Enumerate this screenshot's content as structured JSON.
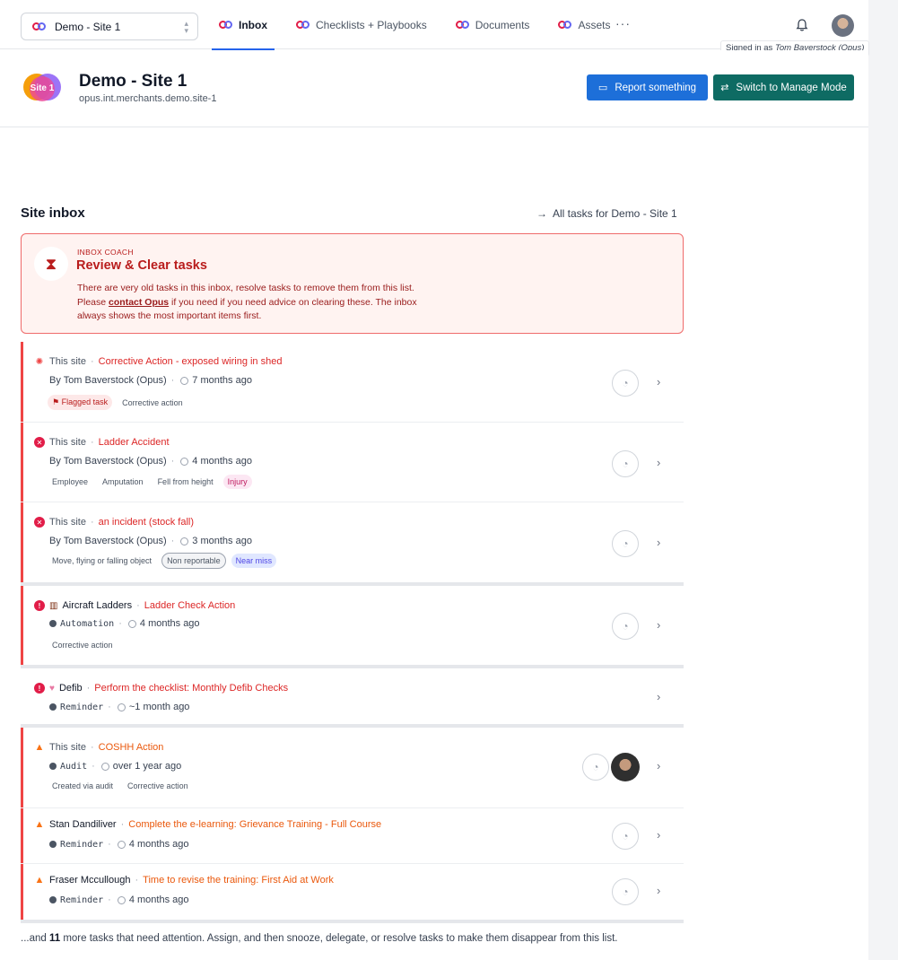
{
  "nav": {
    "site_select": "Demo - Site 1",
    "tabs": [
      {
        "label": "Inbox",
        "active": true
      },
      {
        "label": "Checklists + Playbooks",
        "active": false
      },
      {
        "label": "Documents",
        "active": false
      },
      {
        "label": "Assets",
        "active": false
      }
    ],
    "more": "···",
    "signed_in_prefix": "Signed in as",
    "signed_in_user": "Tom Baverstock (Opus)"
  },
  "site": {
    "badge_text": "Site 1",
    "name": "Demo - Site 1",
    "domain": "opus.int.merchants.demo.site-1",
    "report_button": "Report something",
    "switch_button": "Switch to Manage Mode"
  },
  "inbox": {
    "title": "Site inbox",
    "all_tasks_link": "All tasks for Demo - Site 1",
    "coach": {
      "eyebrow": "INBOX COACH",
      "title": "Review & Clear tasks",
      "body_pre": "There are very old tasks in this inbox, resolve tasks to remove them from this list. Please ",
      "body_link": "contact Opus",
      "body_post": " if you need if you need advice on clearing these. The inbox always shows the most important items first."
    },
    "tasks": [
      {
        "source": "This site",
        "title": "Corrective Action - exposed wiring in shed",
        "by": "By Tom Baverstock (Opus)",
        "ago": "7 months ago",
        "tags": [
          "Flagged task",
          "Corrective action"
        ]
      },
      {
        "source": "This site",
        "title": "Ladder Accident",
        "by": "By Tom Baverstock (Opus)",
        "ago": "4 months ago",
        "tags": [
          "Employee",
          "Amputation",
          "Fell from height",
          "Injury"
        ]
      },
      {
        "source": "This site",
        "title": "an incident (stock fall)",
        "by": "By Tom Baverstock (Opus)",
        "ago": "3 months ago",
        "tags": [
          "Move, flying or falling object",
          "Non reportable",
          "Near miss"
        ]
      },
      {
        "source": "Aircraft Ladders",
        "title": "Ladder Check Action",
        "by": "Automation",
        "ago": "4 months ago",
        "tags": [
          "Corrective action"
        ]
      },
      {
        "source": "Defib",
        "title": "Perform the checklist: Monthly Defib Checks",
        "by": "Reminder",
        "ago": "~1 month ago",
        "tags": []
      },
      {
        "source": "This site",
        "title": "COSHH Action",
        "by": "Audit",
        "ago": "over 1 year ago",
        "tags": [
          "Created via audit",
          "Corrective action"
        ]
      },
      {
        "source": "Stan Dandiliver",
        "title": "Complete the e-learning: Grievance Training - Full Course",
        "by": "Reminder",
        "ago": "4 months ago",
        "tags": []
      },
      {
        "source": "Fraser Mccullough",
        "title": "Time to revise the training: First Aid at Work",
        "by": "Reminder",
        "ago": "4 months ago",
        "tags": []
      }
    ],
    "footer_pre": "...and ",
    "footer_count": "11",
    "footer_post": " more tasks that need attention. Assign, and then snooze, delegate, or resolve tasks to make them disappear from this list."
  },
  "colors": {
    "primary": "#1d6fd9",
    "manage": "#0e6b63",
    "danger": "#dc2626",
    "warning": "#ea580c"
  },
  "icons": [
    "bell-icon",
    "avatar",
    "snooze-icon",
    "chevron-right-icon",
    "hourglass-icon"
  ]
}
